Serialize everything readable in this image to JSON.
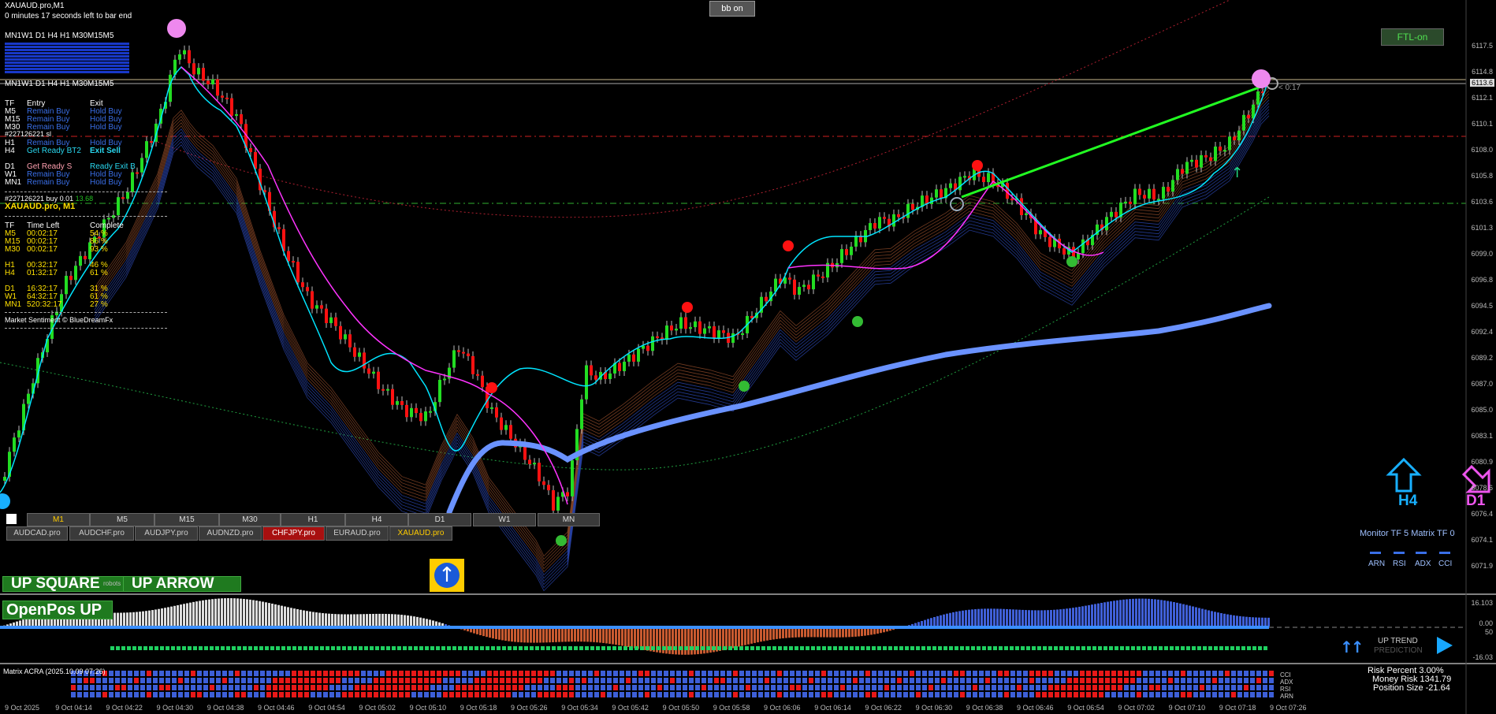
{
  "header": {
    "symbol_tf": "XAUAUD.pro,M1",
    "bar_timer": "0 minutes 17 seconds left to bar end",
    "bb_button": "bb on",
    "ftl_button": "FTL-on",
    "bid_countdown": "< 0:17"
  },
  "tf_strip_top": "MN1W1 D1  H4  H1  M30M15M5",
  "tf_strip_mid": "MN1W1 D1  H4  H1  M30M15M5",
  "signal_table": {
    "headers": [
      "TF",
      "Entry",
      "Exit"
    ],
    "rows": [
      {
        "tf": "M5",
        "entry": "Remain Buy",
        "exit": "Hold Buy"
      },
      {
        "tf": "M15",
        "entry": "Remain Buy",
        "exit": "Hold Buy"
      },
      {
        "tf": "M30",
        "entry": "Remain Buy",
        "exit": "Hold Buy"
      },
      {
        "tf": "H1",
        "entry": "Remain Buy",
        "exit": "Hold Buy"
      },
      {
        "tf": "H4",
        "entry": "Get Ready BT2",
        "exit": "Exit Sell"
      },
      {
        "tf": "D1",
        "entry": "Get Ready S",
        "exit": "Ready Exit B"
      },
      {
        "tf": "W1",
        "entry": "Remain Buy",
        "exit": "Hold Buy"
      },
      {
        "tf": "MN1",
        "entry": "Remain Buy",
        "exit": "Hold Buy"
      }
    ],
    "order_line": "#227126221 sl",
    "order_line2": "#227126221 buy 0.01",
    "order_profit": "13.68",
    "symbol_label": "XAUAUD.pro, M1"
  },
  "time_table": {
    "headers": [
      "TF",
      "Time Left",
      "Complete"
    ],
    "rows": [
      {
        "tf": "M5",
        "left": "00:02:17",
        "pct": "54 %"
      },
      {
        "tf": "M15",
        "left": "00:02:17",
        "pct": "86 %"
      },
      {
        "tf": "M30",
        "left": "00:02:17",
        "pct": "93 %"
      },
      {
        "tf": "H1",
        "left": "00:32:17",
        "pct": "46 %"
      },
      {
        "tf": "H4",
        "left": "01:32:17",
        "pct": "61 %"
      },
      {
        "tf": "D1",
        "left": "16:32:17",
        "pct": "31 %"
      },
      {
        "tf": "W1",
        "left": "64:32:17",
        "pct": "61 %"
      },
      {
        "tf": "MN1",
        "left": "520:32:17",
        "pct": "27 %"
      }
    ],
    "footer": "Market Sentiment © BlueDreamFx"
  },
  "tf_buttons": [
    "M1",
    "M5",
    "M15",
    "M30",
    "H1",
    "H4",
    "D1",
    "W1",
    "MN"
  ],
  "symbol_buttons": [
    "AUDCAD.pro",
    "AUDCHF.pro",
    "AUDJPY.pro",
    "AUDNZD.pro",
    "CHFJPY.pro",
    "EURAUD.pro",
    "XAUAUD.pro"
  ],
  "banners": {
    "up_square": "UP SQUARE",
    "up_arrow": "UP ARROW",
    "openpos": "OpenPos UP",
    "hidden_text": "robots"
  },
  "right_panel": {
    "h4": "H4",
    "d1": "D1",
    "monitor": "Monitor TF 5  Matrix TF 0",
    "indicators": [
      "ARN",
      "RSI",
      "ADX",
      "CCI"
    ],
    "prediction_line1": "UP TREND",
    "prediction_line2": "PREDICTION"
  },
  "matrix": {
    "title": "Matrix ACRA (2025.10.09 07:26)",
    "labels": [
      "CCI",
      "ADX",
      "RSI",
      "ARN"
    ],
    "risk_percent": "Risk Percent  3.00%",
    "money_risk": "Money Risk   1341.79",
    "position_size": "Position Size   -21.64"
  },
  "price_axis": [
    "6117.5",
    "6114.8",
    "6112.1",
    "6110.1",
    "6108.0",
    "6105.8",
    "6103.6",
    "6101.3",
    "6099.0",
    "6096.8",
    "6094.5",
    "6092.4",
    "6089.2",
    "6087.0",
    "6085.0",
    "6083.1",
    "6080.9",
    "6078.6",
    "6076.4",
    "6074.1",
    "6071.9"
  ],
  "current_price": "6113.6",
  "osc_axis": [
    "16.103",
    "0.00",
    "50",
    "-16.03"
  ],
  "time_axis": [
    "9 Oct 2025",
    "9 Oct 04:14",
    "9 Oct 04:22",
    "9 Oct 04:30",
    "9 Oct 04:38",
    "9 Oct 04:46",
    "9 Oct 04:54",
    "9 Oct 05:02",
    "9 Oct 05:10",
    "9 Oct 05:18",
    "9 Oct 05:26",
    "9 Oct 05:34",
    "9 Oct 05:42",
    "9 Oct 05:50",
    "9 Oct 05:58",
    "9 Oct 06:06",
    "9 Oct 06:14",
    "9 Oct 06:22",
    "9 Oct 06:30",
    "9 Oct 06:38",
    "9 Oct 06:46",
    "9 Oct 06:54",
    "9 Oct 07:02",
    "9 Oct 07:10",
    "9 Oct 07:18",
    "9 Oct 07:26"
  ],
  "colors": {
    "bull": "#22dd22",
    "bear": "#ff1111",
    "ma_fast": "#00e5ff",
    "ma_signal": "#ff33ff",
    "ma_slow": "#4f7be8",
    "trend_line": "#22ff22",
    "matrix_blue": "#3d5fd8",
    "matrix_red": "#e81818"
  }
}
